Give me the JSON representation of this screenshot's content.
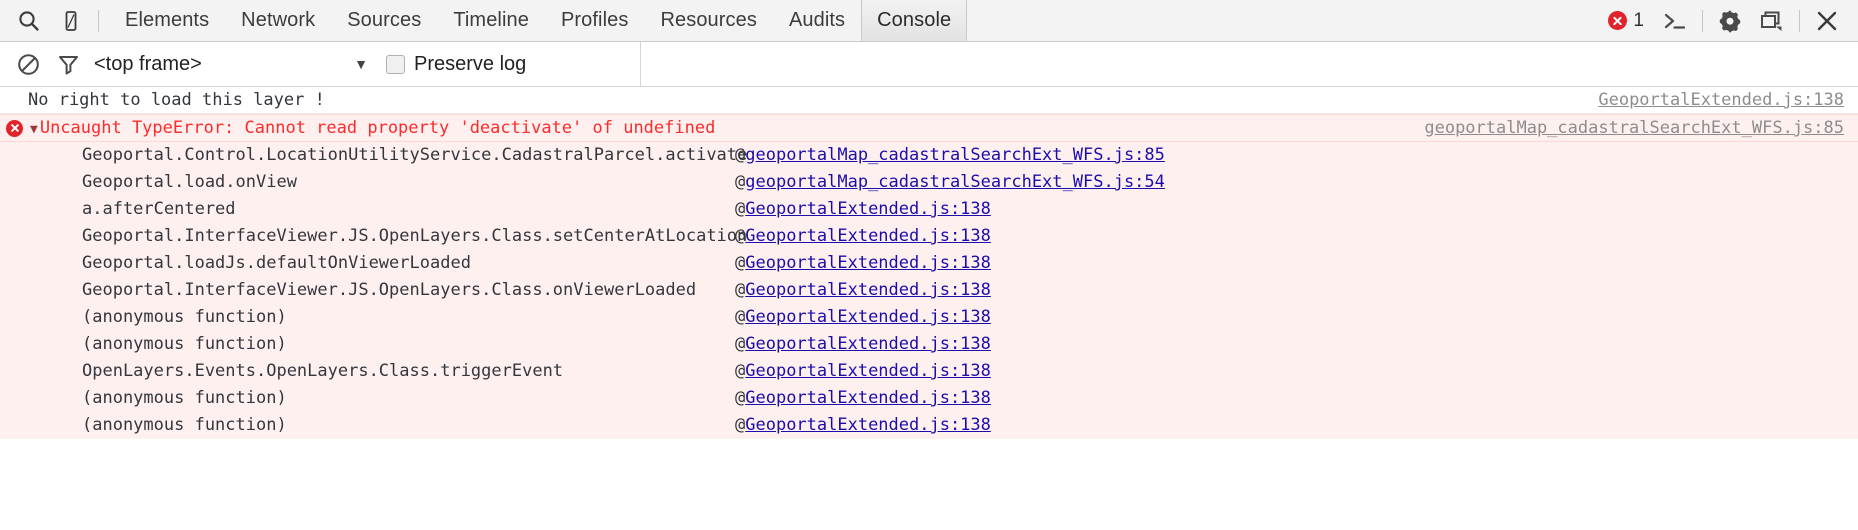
{
  "toolbar": {
    "icons": [
      {
        "name": "search-icon",
        "glyph": "search"
      },
      {
        "name": "device-mode-icon",
        "glyph": "device"
      }
    ],
    "tabs": [
      {
        "label": "Elements",
        "active": false
      },
      {
        "label": "Network",
        "active": false
      },
      {
        "label": "Sources",
        "active": false
      },
      {
        "label": "Timeline",
        "active": false
      },
      {
        "label": "Profiles",
        "active": false
      },
      {
        "label": "Resources",
        "active": false
      },
      {
        "label": "Audits",
        "active": false
      },
      {
        "label": "Console",
        "active": true
      }
    ],
    "error_count": "1",
    "prompt_icon_label": ">_",
    "settings_icon": "gear-icon",
    "dock_icon": "dock-side-icon",
    "close_icon": "close-icon"
  },
  "filterbar": {
    "clear_icon": "clear-console-icon",
    "filter_icon": "filter-icon",
    "frame_selector_value": "<top frame>",
    "caret": "▼",
    "preserve_log_label": "Preserve log",
    "preserve_log_checked": false
  },
  "console": {
    "messages": [
      {
        "type": "log",
        "text": "No right to load this layer !",
        "source_link": "GeoportalExtended.js:138",
        "link_style": "gray"
      },
      {
        "type": "error",
        "text": "Uncaught TypeError: Cannot read property 'deactivate' of undefined",
        "source_link": "geoportalMap_cadastralSearchExt_WFS.js:85",
        "link_style": "gray",
        "expanded": true
      }
    ],
    "stack_frames": [
      {
        "fn": "Geoportal.Control.LocationUtilityService.CadastralParcel.activate",
        "at": "@",
        "link": "geoportalMap_cadastralSearchExt_WFS.js:85"
      },
      {
        "fn": "Geoportal.load.onView",
        "at": "@",
        "link": "geoportalMap_cadastralSearchExt_WFS.js:54"
      },
      {
        "fn": "a.afterCentered",
        "at": "@",
        "link": "GeoportalExtended.js:138"
      },
      {
        "fn": "Geoportal.InterfaceViewer.JS.OpenLayers.Class.setCenterAtLocation",
        "at": "@",
        "link": "GeoportalExtended.js:138"
      },
      {
        "fn": "Geoportal.loadJs.defaultOnViewerLoaded",
        "at": "@",
        "link": "GeoportalExtended.js:138"
      },
      {
        "fn": "Geoportal.InterfaceViewer.JS.OpenLayers.Class.onViewerLoaded",
        "at": "@",
        "link": "GeoportalExtended.js:138"
      },
      {
        "fn": "(anonymous function)",
        "at": "@",
        "link": "GeoportalExtended.js:138"
      },
      {
        "fn": "(anonymous function)",
        "at": "@",
        "link": "GeoportalExtended.js:138"
      },
      {
        "fn": "OpenLayers.Events.OpenLayers.Class.triggerEvent",
        "at": "@",
        "link": "GeoportalExtended.js:138"
      },
      {
        "fn": "(anonymous function)",
        "at": "@",
        "link": "GeoportalExtended.js:138"
      },
      {
        "fn": "(anonymous function)",
        "at": "@",
        "link": "GeoportalExtended.js:138"
      }
    ]
  },
  "colors": {
    "error_red": "#fd2b2b",
    "error_bg": "#fff0f0",
    "link_blue": "#1a0dab",
    "link_gray": "#8d8d8d",
    "badge_red": "#e0242a",
    "toolbar_bg": "#f3f3f3"
  }
}
